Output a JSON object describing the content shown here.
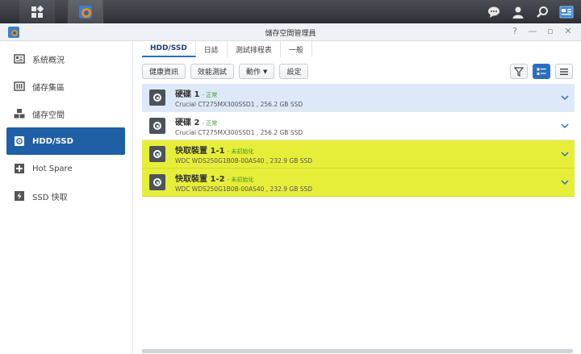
{
  "window": {
    "title": "儲存空間管理員"
  },
  "sidebar": {
    "items": [
      {
        "label": "系統概況",
        "icon": "overview-icon"
      },
      {
        "label": "儲存集區",
        "icon": "storage-pool-icon"
      },
      {
        "label": "儲存空間",
        "icon": "volume-icon"
      },
      {
        "label": "HDD/SSD",
        "icon": "hdd-icon"
      },
      {
        "label": "Hot Spare",
        "icon": "hot-spare-icon"
      },
      {
        "label": "SSD 快取",
        "icon": "ssd-cache-icon"
      }
    ],
    "active_index": 3
  },
  "tabs": [
    {
      "label": "HDD/SSD"
    },
    {
      "label": "日誌"
    },
    {
      "label": "測試排程表"
    },
    {
      "label": "一般"
    }
  ],
  "toolbar": {
    "health_label": "健康資訊",
    "benchmark_label": "效能測試",
    "action_label": "動作",
    "settings_label": "設定"
  },
  "disks": [
    {
      "name": "硬碟 1",
      "status": "- 正常",
      "desc": "Crucial CT275MX300SSD1 , 256.2 GB SSD"
    },
    {
      "name": "硬碟 2",
      "status": "- 正常",
      "desc": "Crucial CT275MX300SSD1 , 256.2 GB SSD"
    },
    {
      "name": "快取裝置 1-1",
      "status": "- 未初始化",
      "desc": "WDC WDS250G1B0B-00AS40 , 232.9 GB SSD"
    },
    {
      "name": "快取裝置 1-2",
      "status": "- 未初始化",
      "desc": "WDC WDS250G1B0B-00AS40 , 232.9 GB SSD"
    }
  ],
  "colors": {
    "accent": "#1f5fa6",
    "highlight": "#e6ee3a",
    "status_ok": "#3a9a2a"
  }
}
